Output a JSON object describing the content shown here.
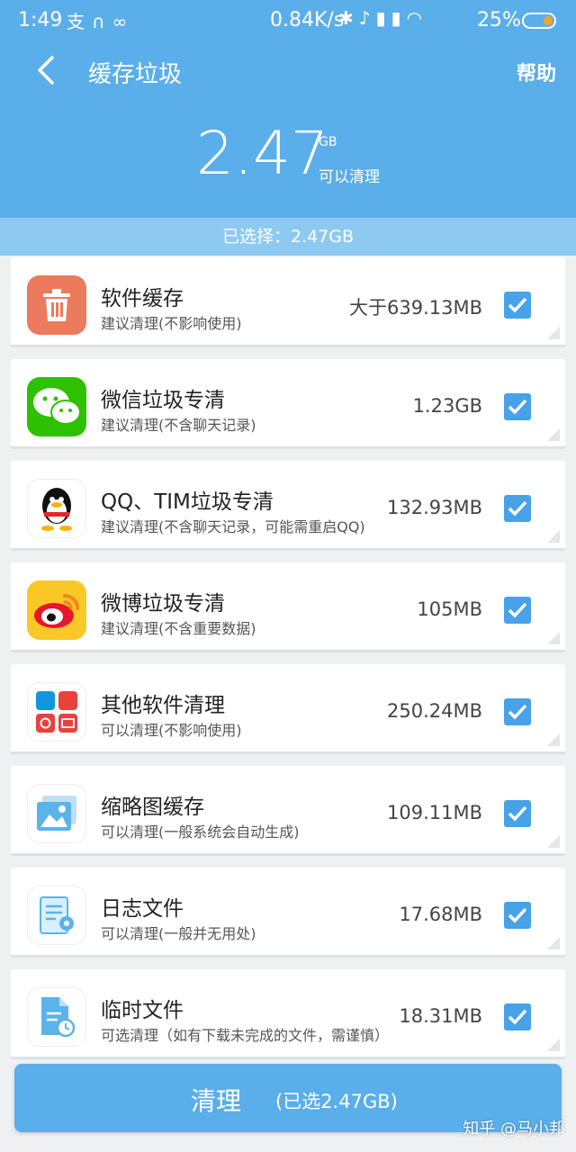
{
  "status_bar": {
    "time": "1:49",
    "speed": "0.84K/s",
    "battery": "25%",
    "left_icons": [
      "alipay-icon",
      "headset-icon",
      "link-icon"
    ],
    "right_icons": [
      "bluetooth-icon",
      "mute-icon",
      "signal-icon",
      "signal-icon",
      "wifi-icon"
    ]
  },
  "header": {
    "title": "缓存垃圾",
    "help_label": "帮助",
    "total_size": "2.47",
    "total_unit": "GB",
    "total_caption": "可以清理",
    "background_color": "#5aaeea"
  },
  "selection_bar": {
    "text": "已选择：2.47GB"
  },
  "items": [
    {
      "title": "软件缓存",
      "subtitle": "建议清理(不影响使用)",
      "size": "大于639.13MB",
      "checked": true,
      "icon": "trash-icon"
    },
    {
      "title": "微信垃圾专清",
      "subtitle": "建议清理(不含聊天记录)",
      "size": "1.23GB",
      "checked": true,
      "icon": "wechat-icon"
    },
    {
      "title": "QQ、TIM垃圾专清",
      "subtitle": "建议清理(不含聊天记录，可能需重启QQ)",
      "size": "132.93MB",
      "checked": true,
      "icon": "qq-icon"
    },
    {
      "title": "微博垃圾专清",
      "subtitle": "建议清理(不含重要数据)",
      "size": "105MB",
      "checked": true,
      "icon": "weibo-icon"
    },
    {
      "title": "其他软件清理",
      "subtitle": "可以清理(不影响使用)",
      "size": "250.24MB",
      "checked": true,
      "icon": "apps-grid-icon"
    },
    {
      "title": "缩略图缓存",
      "subtitle": "可以清理(一般系统会自动生成)",
      "size": "109.11MB",
      "checked": true,
      "icon": "image-icon"
    },
    {
      "title": "日志文件",
      "subtitle": "可以清理(一般并无用处)",
      "size": "17.68MB",
      "checked": true,
      "icon": "log-file-icon"
    },
    {
      "title": "临时文件",
      "subtitle": "可选清理（如有下载未完成的文件，需谨慎）",
      "size": "18.31MB",
      "checked": true,
      "icon": "temp-file-icon"
    }
  ],
  "clean_button": {
    "label": "清理",
    "sub_label": "(已选2.47GB)"
  },
  "watermark": "知乎 @马小邦",
  "colors": {
    "accent": "#5aaeea",
    "checkbox": "#47a2e8"
  }
}
